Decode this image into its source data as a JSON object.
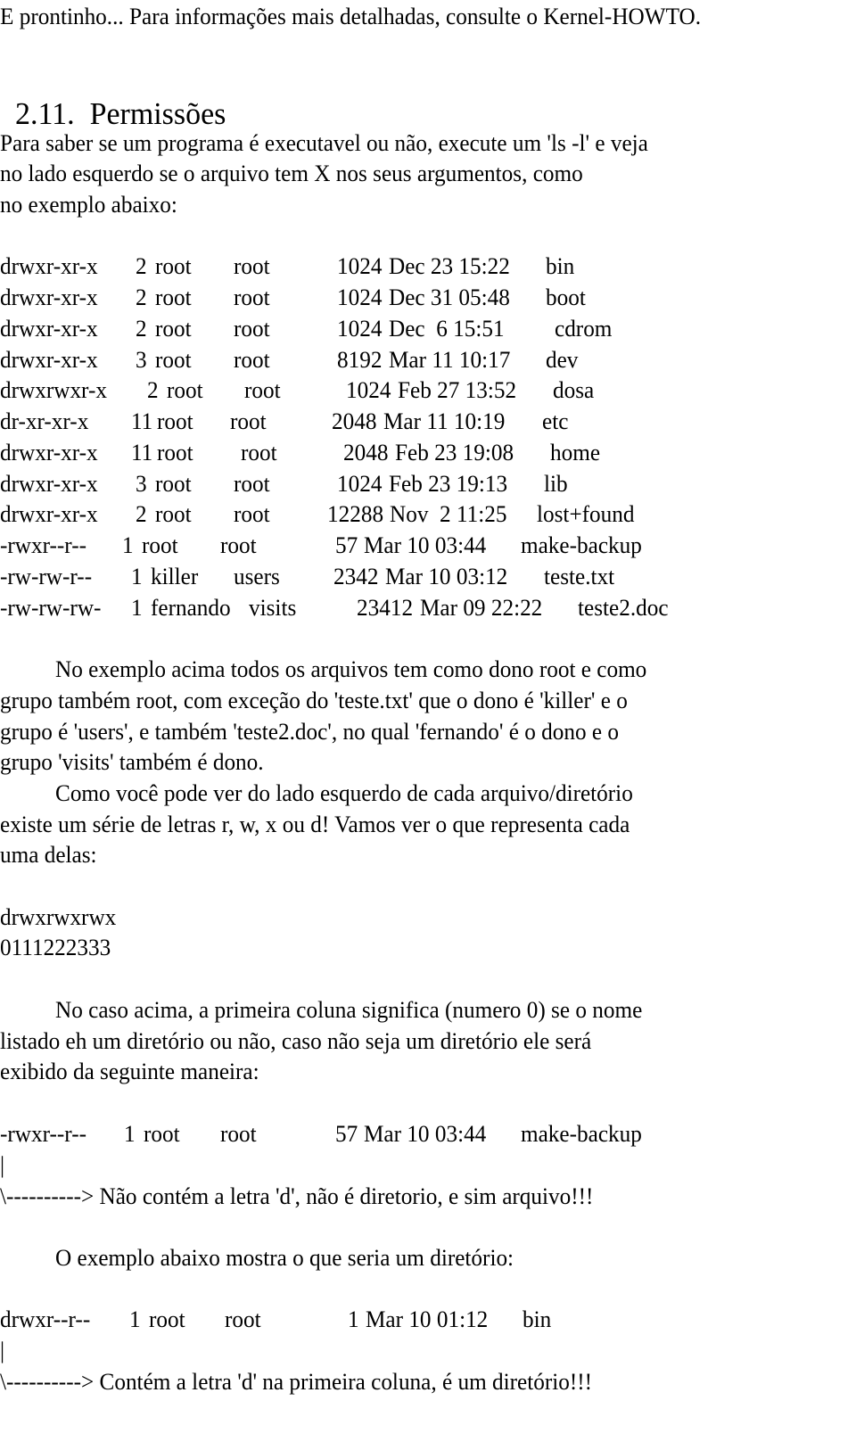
{
  "intro_line": "E prontinho... Para informações mais detalhadas, consulte o Kernel-HOWTO.",
  "section": {
    "number": "2.11.",
    "title": "Permissões"
  },
  "paragraph_1": [
    "Para saber se um programa é executavel ou não, execute um 'ls -l' e veja",
    "no lado esquerdo se o arquivo tem X nos seus argumentos, como",
    "no exemplo abaixo:"
  ],
  "listing": [
    {
      "perms": "drwxr-xr-x",
      "links": "2",
      "owner": "root",
      "group": "root",
      "size": "1024",
      "date": "Dec 23 15:22",
      "name": "bin"
    },
    {
      "perms": "drwxr-xr-x",
      "links": "2",
      "owner": "root",
      "group": "root",
      "size": "1024",
      "date": "Dec 31 05:48",
      "name": "boot"
    },
    {
      "perms": "drwxr-xr-x",
      "links": "2",
      "owner": "root",
      "group": "root",
      "size": "1024",
      "date": "Dec  6 15:51",
      "name": "cdrom"
    },
    {
      "perms": "drwxr-xr-x",
      "links": "3",
      "owner": "root",
      "group": "root",
      "size": "8192",
      "date": "Mar 11 10:17",
      "name": "dev"
    },
    {
      "perms": "drwxrwxr-x",
      "links": "2",
      "owner": "root",
      "group": "root",
      "size": "1024",
      "date": "Feb 27 13:52",
      "name": "dosa"
    },
    {
      "perms": "dr-xr-xr-x",
      "links": "11",
      "owner": "root",
      "group": "root",
      "size": "2048",
      "date": "Mar 11 10:19",
      "name": "etc"
    },
    {
      "perms": "drwxr-xr-x",
      "links": "11",
      "owner": "root",
      "group": "root",
      "size": "2048",
      "date": "Feb 23 19:08",
      "name": "home"
    },
    {
      "perms": "drwxr-xr-x",
      "links": "3",
      "owner": "root",
      "group": "root",
      "size": "1024",
      "date": "Feb 23 19:13",
      "name": "lib"
    },
    {
      "perms": "drwxr-xr-x",
      "links": "2",
      "owner": "root",
      "group": "root",
      "size": "12288",
      "date": "Nov  2 11:25",
      "name": "lost+found"
    },
    {
      "perms": "-rwxr--r--",
      "links": "1",
      "owner": "root",
      "group": "root",
      "size": "57",
      "date": "Mar 10 03:44",
      "name": "make-backup"
    },
    {
      "perms": "-rw-rw-r--",
      "links": "1",
      "owner": "killer",
      "group": "users",
      "size": "2342",
      "date": "Mar 10 03:12",
      "name": "teste.txt"
    },
    {
      "perms": "-rw-rw-rw-",
      "links": "1",
      "owner": "fernando",
      "group": "visits",
      "size": "23412",
      "date": "Mar 09 22:22",
      "name": "teste2.doc"
    }
  ],
  "paragraph_2": [
    "No exemplo acima todos os arquivos tem como dono root e como",
    "grupo também root, com exceção do 'teste.txt' que o dono é 'killer' e o",
    "grupo é 'users', e também 'teste2.doc', no qual 'fernando' é o dono e o",
    "grupo 'visits' também é dono."
  ],
  "paragraph_3": [
    "Como você pode ver do lado esquerdo de cada arquivo/diretório",
    "existe um série de letras r, w, x ou d! Vamos ver o que representa cada",
    "uma delas:"
  ],
  "perm_example": {
    "letters": "drwxrwxrwx",
    "digits": "0111222333"
  },
  "paragraph_4": [
    "No caso acima, a primeira coluna significa (numero 0) se o nome",
    "listado eh um diretório ou não, caso não seja um diretório ele será",
    "exibido da seguinte maneira:"
  ],
  "file_example": {
    "perms": "-rwxr--r--",
    "links": "1",
    "owner": "root",
    "group": "root",
    "size": "57",
    "date": "Mar 10 03:44",
    "name": "make-backup",
    "pipe": "|",
    "arrow_note": "\\----------> Não contém a letra 'd', não é diretorio, e sim arquivo!!!"
  },
  "paragraph_5": "O exemplo abaixo mostra o que seria um diretório:",
  "dir_example": {
    "perms": "drwxr--r--",
    "links": "1",
    "owner": "root",
    "group": "root",
    "size": "1",
    "date": "Mar 10 01:12",
    "name": "bin",
    "pipe": "|",
    "arrow_note": "\\----------> Contém a letra 'd' na primeira coluna, é um diretório!!!"
  }
}
